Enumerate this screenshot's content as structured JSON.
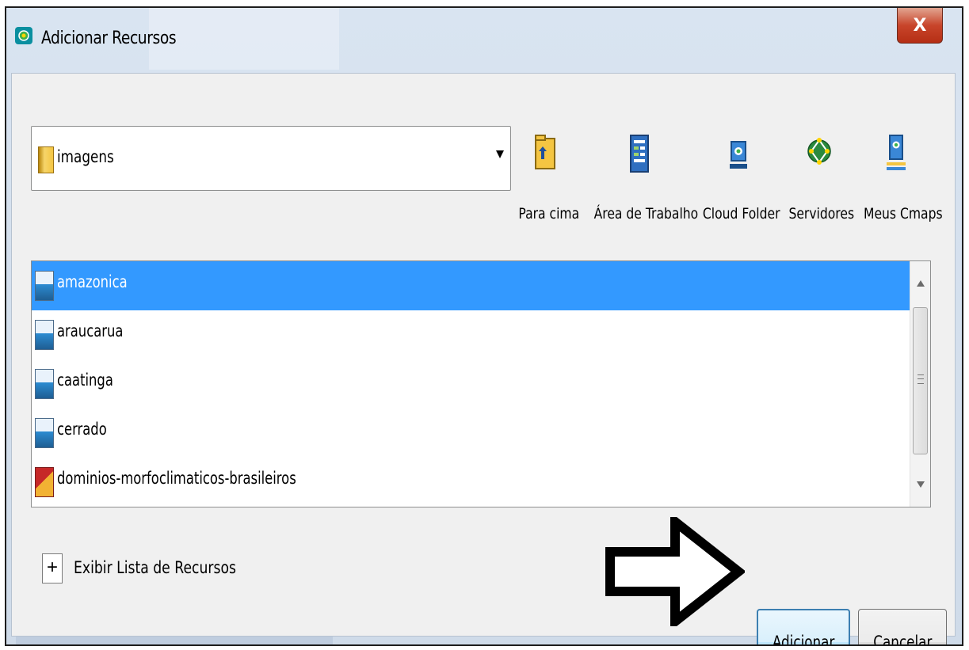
{
  "window": {
    "title": "Adicionar Recursos",
    "close_label": "X"
  },
  "folder_combo": {
    "value": "imagens"
  },
  "nav_buttons": [
    {
      "label": "Para cima",
      "icon": "folder-up-icon"
    },
    {
      "label": "Área de Trabalho",
      "icon": "desktop-icon"
    },
    {
      "label": "Cloud Folder",
      "icon": "cloud-folder-icon"
    },
    {
      "label": "Servidores",
      "icon": "servers-icon"
    },
    {
      "label": "Meus Cmaps",
      "icon": "my-cmaps-icon"
    }
  ],
  "files": [
    {
      "name": "amazonica",
      "type": "image",
      "selected": true
    },
    {
      "name": "araucarua",
      "type": "image",
      "selected": false
    },
    {
      "name": "caatinga",
      "type": "image",
      "selected": false
    },
    {
      "name": "cerrado",
      "type": "image",
      "selected": false
    },
    {
      "name": "dominios-morfoclimaticos-brasileiros",
      "type": "pdf",
      "selected": false
    }
  ],
  "resource_list_toggle": {
    "symbol": "+",
    "label": "Exibir Lista de Recursos"
  },
  "buttons": {
    "add": "Adicionar",
    "cancel": "Cancelar"
  },
  "colors": {
    "selection": "#3399ff",
    "close": "#c8452b",
    "dialog_bg": "#f0f0f0"
  }
}
